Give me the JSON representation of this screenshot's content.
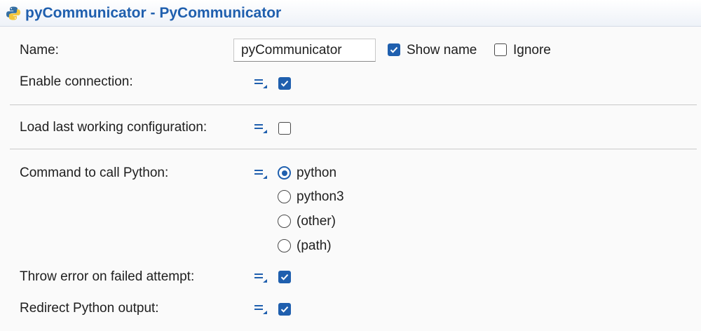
{
  "window": {
    "title": "pyCommunicator - PyCommunicator",
    "icon": "python-icon"
  },
  "name_row": {
    "label": "Name:",
    "value": "pyCommunicator",
    "show_name": {
      "label": "Show name",
      "checked": true
    },
    "ignore": {
      "label": "Ignore",
      "checked": false
    }
  },
  "fields": {
    "enable_connection": {
      "label": "Enable connection:",
      "checked": true
    },
    "load_last_config": {
      "label": "Load last working configuration:",
      "checked": false
    },
    "command_python": {
      "label": "Command to call Python:",
      "selected": "python",
      "options": [
        "python",
        "python3",
        "(other)",
        "(path)"
      ]
    },
    "throw_error": {
      "label": "Throw error on failed attempt:",
      "checked": true
    },
    "redirect_output": {
      "label": "Redirect Python output:",
      "checked": true
    }
  },
  "icons": {
    "option_icon": "flow-variable-icon"
  },
  "colors": {
    "accent": "#1f5fae",
    "title": "#1f5fae"
  }
}
